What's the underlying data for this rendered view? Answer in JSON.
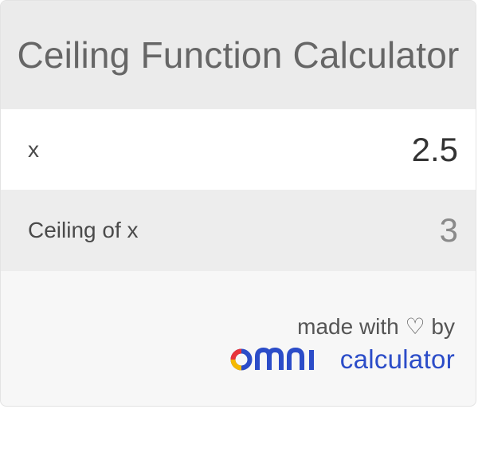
{
  "header": {
    "title": "Ceiling Function Calculator"
  },
  "input_row": {
    "label": "x",
    "value": "2.5"
  },
  "output_row": {
    "label": "Ceiling of x",
    "value": "3"
  },
  "footer": {
    "made_with": "made with ♡ by",
    "brand_word": "omni",
    "brand_calc": "calculator"
  },
  "colors": {
    "header_bg": "#ebebeb",
    "brand_blue": "#2b4cc8",
    "logo_red": "#e8333a",
    "logo_yellow": "#f5b800",
    "logo_blue": "#2b4cc8"
  },
  "icons": {
    "heart": "heart-outline-icon",
    "logo": "omni-logo-icon"
  }
}
